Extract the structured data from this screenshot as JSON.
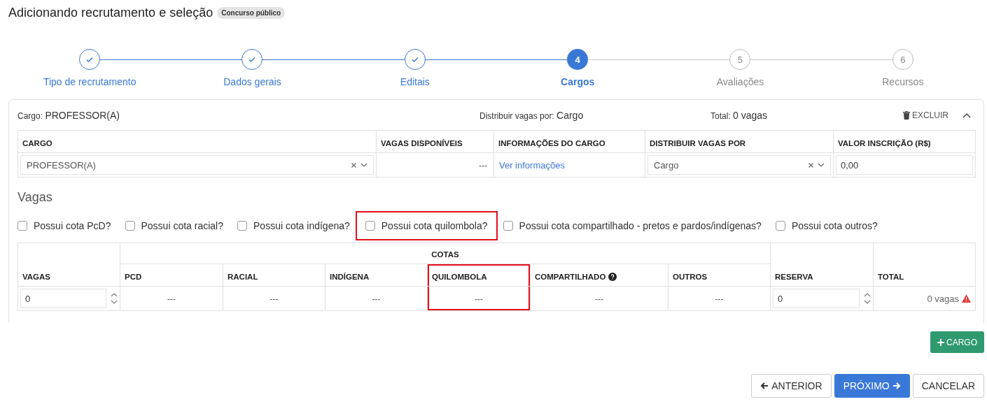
{
  "page": {
    "title": "Adicionando recrutamento e seleção",
    "badge": "Concurso público"
  },
  "steps": [
    {
      "label": "Tipo de recrutamento",
      "done": true,
      "selected": false
    },
    {
      "label": "Dados gerais",
      "done": true,
      "selected": false
    },
    {
      "label": "Editais",
      "done": true,
      "selected": false
    },
    {
      "label": "Cargos",
      "number": "4",
      "done": false,
      "selected": true
    },
    {
      "label": "Avaliações",
      "number": "5",
      "done": false,
      "selected": false
    },
    {
      "label": "Recursos",
      "number": "6",
      "done": false,
      "selected": false
    }
  ],
  "cargo_card": {
    "title_label": "Cargo:",
    "title_value": "PROFESSOR(A)",
    "distribuir_label": "Distribuir vagas por:",
    "distribuir_value": "Cargo",
    "total_label": "Total:",
    "total_value": "0 vagas",
    "delete_button": "EXCLUIR",
    "expanded": true,
    "columns": [
      {
        "label": "CARGO",
        "kind": "select",
        "value": "PROFESSOR(A)"
      },
      {
        "label": "VAGAS DISPONÍVEIS",
        "kind": "text",
        "value": "---"
      },
      {
        "label": "INFORMAÇÕES DO CARGO",
        "kind": "link",
        "value": "Ver informações"
      },
      {
        "label": "DISTRIBUIR VAGAS POR",
        "kind": "select",
        "value": "Cargo"
      },
      {
        "label": "VALOR INSCRIÇÃO (R$)",
        "kind": "input",
        "value": "0,00"
      }
    ]
  },
  "vagas": {
    "heading": "Vagas",
    "quota_options": [
      {
        "label": "Possui cota PcD?",
        "checked": false,
        "highlighted": false
      },
      {
        "label": "Possui cota racial?",
        "checked": false,
        "highlighted": false
      },
      {
        "label": "Possui cota indígena?",
        "checked": false,
        "highlighted": false
      },
      {
        "label": "Possui cota quilombola?",
        "checked": false,
        "highlighted": true
      },
      {
        "label": "Possui cota compartilhado - pretos e pardos/indígenas?",
        "checked": false,
        "highlighted": false
      },
      {
        "label": "Possui cota outros?",
        "checked": false,
        "highlighted": false
      }
    ],
    "group_header": "COTAS",
    "columns": [
      {
        "label": "VAGAS",
        "kind": "number",
        "value": "0",
        "highlighted": false
      },
      {
        "label": "PCD",
        "kind": "quota",
        "value": "---",
        "highlighted": false
      },
      {
        "label": "RACIAL",
        "kind": "quota",
        "value": "---",
        "highlighted": false
      },
      {
        "label": "INDÍGENA",
        "kind": "quota",
        "value": "---",
        "highlighted": false
      },
      {
        "label": "QUILOMBOLA",
        "kind": "quota",
        "value": "---",
        "highlighted": true
      },
      {
        "label": "COMPARTILHADO",
        "kind": "quota",
        "value": "---",
        "highlighted": false,
        "help": true
      },
      {
        "label": "OUTROS",
        "kind": "quota",
        "value": "---",
        "highlighted": false
      },
      {
        "label": "RESERVA",
        "kind": "number",
        "value": "0",
        "highlighted": false
      },
      {
        "label": "TOTAL",
        "kind": "total",
        "value": "0 vagas",
        "highlighted": false,
        "warning": true
      }
    ]
  },
  "add_button": "CARGO",
  "nav_buttons": [
    {
      "label": "ANTERIOR",
      "kind": "back"
    },
    {
      "label": "PRÓXIMO",
      "kind": "next"
    },
    {
      "label": "CANCELAR",
      "kind": "cancel"
    }
  ]
}
